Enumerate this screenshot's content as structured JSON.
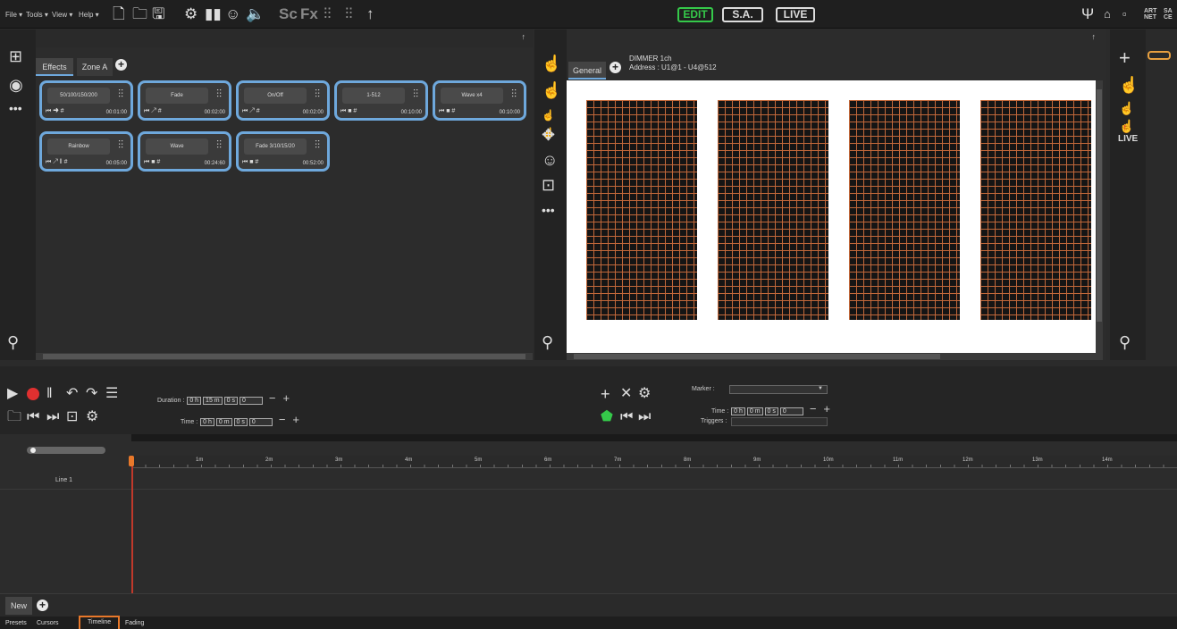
{
  "menu": {
    "file": "File",
    "tools": "Tools",
    "view": "View",
    "help": "Help"
  },
  "modes": {
    "edit": "EDIT",
    "sa": "S.A.",
    "live": "LIVE"
  },
  "artnet": "ART NET",
  "right_cut_label": "SA CE",
  "left_panel": {
    "tabs": [
      "Effects",
      "Zone A"
    ],
    "cards": [
      {
        "name": "50/100/150/200",
        "icons": "⏮ ➜ #",
        "time": "00:01:00"
      },
      {
        "name": "Fade",
        "icons": "⏮ ↗ #",
        "time": "00:02:00"
      },
      {
        "name": "On/Off",
        "icons": "⏮ ↗ #",
        "time": "00:02:00"
      },
      {
        "name": "1-512",
        "icons": "⏮ ■ #",
        "time": "00:10:00"
      },
      {
        "name": "Wave x4",
        "icons": "⏮ ■ #",
        "time": "00:10:00"
      },
      {
        "name": "Rainbow",
        "icons": "⏮ ↗ ǁ #",
        "time": "00:05:00"
      },
      {
        "name": "Wave",
        "icons": "⏮ ■ #",
        "time": "00:24:60"
      },
      {
        "name": "Fade 3/10/15/20",
        "icons": "⏮ ■ #",
        "time": "00:52:00"
      }
    ]
  },
  "middle_panel": {
    "tab": "General",
    "fixture_name": "DIMMER 1ch",
    "fixture_address": "Address : U1@1 - U4@512"
  },
  "right_panel": {
    "live_label": "LIVE"
  },
  "timeline": {
    "duration_label": "Duration :",
    "duration": {
      "h": "0 h",
      "m": "15 m",
      "s": "0 s",
      "f": "0"
    },
    "time_label": "Time :",
    "time": {
      "h": "0 h",
      "m": "0 m",
      "s": "0 s",
      "f": "0"
    },
    "marker_label": "Marker :",
    "marker_time_label": "Time :",
    "marker_time": {
      "h": "0 h",
      "m": "0 m",
      "s": "0 s",
      "f": "0"
    },
    "triggers_label": "Triggers :",
    "ruler": [
      "1m",
      "2m",
      "3m",
      "4m",
      "5m",
      "6m",
      "7m",
      "8m",
      "9m",
      "10m",
      "11m",
      "12m",
      "13m",
      "14m"
    ],
    "line_label": "Line 1",
    "new_label": "New"
  },
  "bottom_tabs": [
    "Presets",
    "Cursors",
    "Timeline",
    "Fading"
  ],
  "active_bottom_tab": "Timeline",
  "colors": {
    "accent_blue": "#6ea8dc",
    "edit_green": "#35c94a",
    "record_red": "#e03030",
    "tab_highlight": "#e8782a",
    "grid_orange": "#c2683a"
  }
}
